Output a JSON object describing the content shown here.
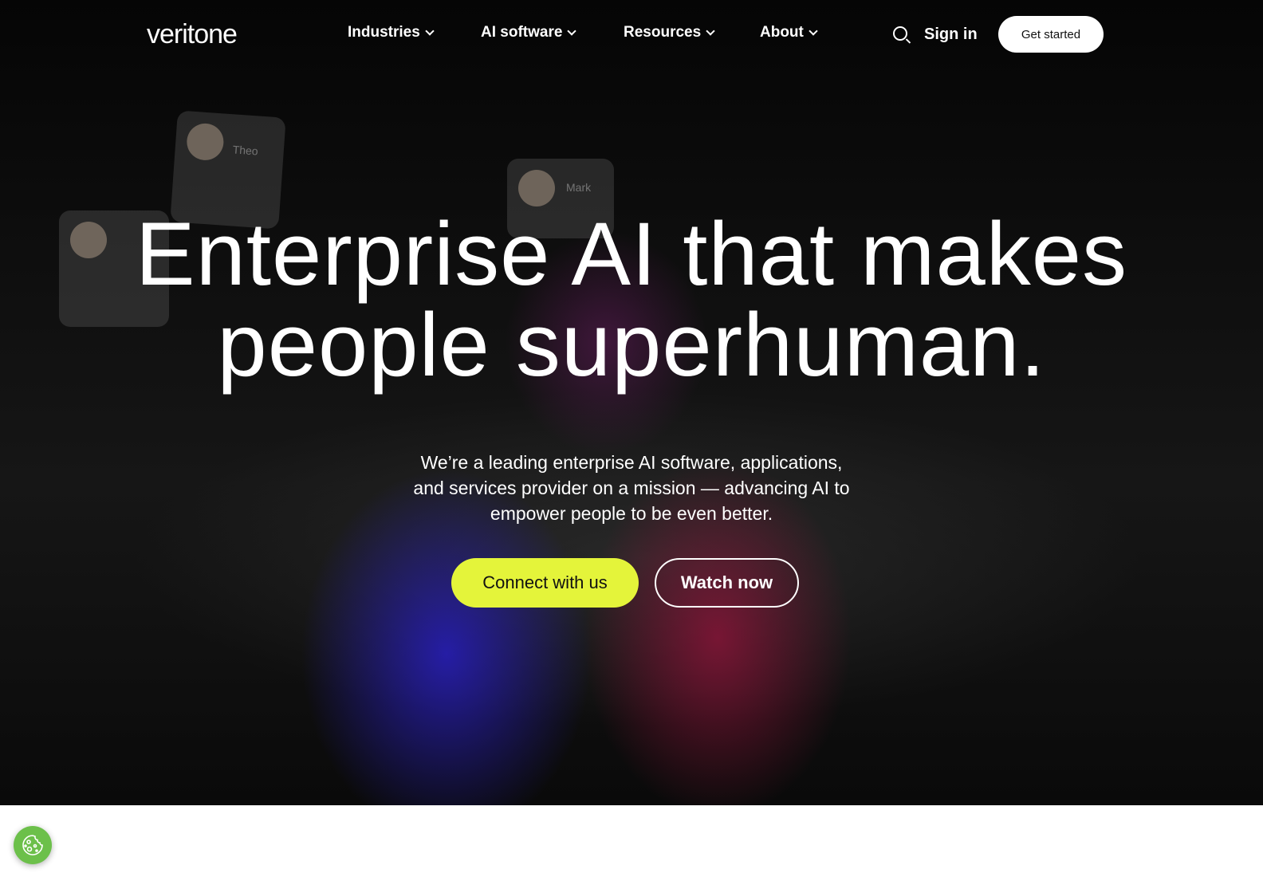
{
  "nav": {
    "logo": "veritone",
    "items": [
      {
        "label": "Industries"
      },
      {
        "label": "AI software"
      },
      {
        "label": "Resources"
      },
      {
        "label": "About"
      }
    ],
    "sign_in": "Sign in",
    "get_started": "Get started"
  },
  "hero": {
    "title_line1": "Enterprise AI that makes",
    "title_line2": "people superhuman.",
    "subtitle_line1": "We’re a leading enterprise AI software, applications,",
    "subtitle_line2": "and services provider on a mission — advancing AI to",
    "subtitle_line3": "empower people to be even better.",
    "connect_label": "Connect with us",
    "watch_label": "Watch now",
    "cards": [
      {
        "name": "Theo"
      },
      {
        "name": "Mark"
      }
    ]
  },
  "colors": {
    "accent": "#e4f43a",
    "cookie": "#6cc04a"
  },
  "cookie": {
    "icon": "cookie-icon"
  }
}
